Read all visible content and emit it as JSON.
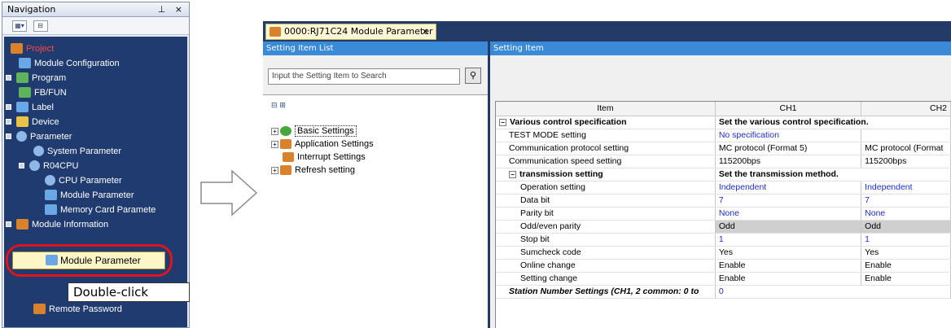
{
  "navigation": {
    "title": "Navigation",
    "title_controls": "⊥ ×",
    "toolbar": [
      "tree-options",
      "tree-view"
    ],
    "items": {
      "project": "Project",
      "module_configuration": "Module Configuration",
      "program": "Program",
      "fb_fun": "FB/FUN",
      "label": "Label",
      "device": "Device",
      "parameter": "Parameter",
      "system_parameter": "System Parameter",
      "r04cpu": "R04CPU",
      "cpu_parameter": "CPU Parameter",
      "module_parameter": "Module Parameter",
      "memory_card_parameter": "Memory Card Paramete",
      "module_information": "Module Information",
      "highlighted_module_parameter": "Module Parameter",
      "remote_password": "Remote Password"
    },
    "callout": "Double-click"
  },
  "editor": {
    "tab_title": "0000:RJ71C24 Module Parameter",
    "tab_close": "×",
    "setting_item_list_header": "Setting Item List",
    "setting_item_header": "Setting Item",
    "search": {
      "placeholder": "Input the Setting Item to Search",
      "button_icon": "binoculars-icon"
    },
    "tree": [
      {
        "label": "Basic Settings",
        "icon": "check-circle-icon"
      },
      {
        "label": "Application Settings",
        "icon": "module-icon"
      },
      {
        "label": "Interrupt Settings",
        "icon": "module-icon"
      },
      {
        "label": "Refresh setting",
        "icon": "module-icon"
      }
    ],
    "grid": {
      "columns": [
        "Item",
        "CH1",
        "CH2"
      ],
      "rows": [
        {
          "item": "Various control specification",
          "ch1": "Set the various control specification.",
          "ch2": ""
        },
        {
          "item": "TEST MODE setting",
          "ch1": "No specification",
          "ch2": ""
        },
        {
          "item": "Communication protocol setting",
          "ch1": "MC protocol (Format 5)",
          "ch2": "MC protocol (Format"
        },
        {
          "item": "Communication speed setting",
          "ch1": "115200bps",
          "ch2": "115200bps"
        },
        {
          "item": "transmission setting",
          "ch1": "Set the transmission method.",
          "ch2": ""
        },
        {
          "item": "Operation setting",
          "ch1": "Independent",
          "ch2": "Independent"
        },
        {
          "item": "Data bit",
          "ch1": "7",
          "ch2": "7"
        },
        {
          "item": "Parity bit",
          "ch1": "None",
          "ch2": "None"
        },
        {
          "item": "Odd/even parity",
          "ch1": "Odd",
          "ch2": "Odd"
        },
        {
          "item": "Stop bit",
          "ch1": "1",
          "ch2": "1"
        },
        {
          "item": "Sumcheck code",
          "ch1": "Yes",
          "ch2": "Yes"
        },
        {
          "item": "Online change",
          "ch1": "Enable",
          "ch2": "Enable"
        },
        {
          "item": "Setting change",
          "ch1": "Enable",
          "ch2": "Enable"
        },
        {
          "item": "Station Number Settings (CH1, 2 common: 0 to",
          "ch1": "0",
          "ch2": ""
        }
      ]
    }
  },
  "colors": {
    "nav_tree_bg": "#1f3b6f",
    "header_blue": "#3a8ad8",
    "highlight_ring": "#e0151b",
    "value_blue": "#1d2fcc"
  }
}
